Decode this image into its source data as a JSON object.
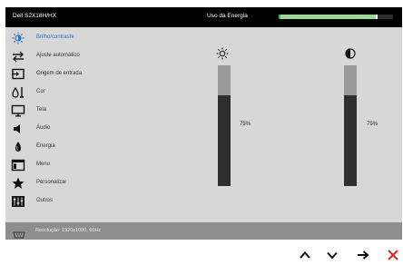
{
  "header": {
    "model": "Dell S2X18H/HX",
    "energy_label": "Uso da Energia",
    "energy_level": 0.85
  },
  "menu": {
    "items": [
      {
        "id": "brightness",
        "label": "Brilho/contraste",
        "icon": "brightness-icon",
        "active": true
      },
      {
        "id": "auto-adjust",
        "label": "Ajuste automático",
        "icon": "auto-adjust-icon",
        "active": false
      },
      {
        "id": "input-source",
        "label": "Origem de entrada",
        "icon": "input-source-icon",
        "active": false
      },
      {
        "id": "color",
        "label": "Cor",
        "icon": "color-icon",
        "active": false
      },
      {
        "id": "display",
        "label": "Tela",
        "icon": "display-icon",
        "active": false
      },
      {
        "id": "audio",
        "label": "Áudio",
        "icon": "audio-icon",
        "active": false
      },
      {
        "id": "energy",
        "label": "Energia",
        "icon": "energy-icon",
        "active": false
      },
      {
        "id": "menu",
        "label": "Menu",
        "icon": "menu-icon",
        "active": false
      },
      {
        "id": "personalize",
        "label": "Personalizar",
        "icon": "star-icon",
        "active": false
      },
      {
        "id": "others",
        "label": "Outros",
        "icon": "others-icon",
        "active": false
      }
    ]
  },
  "brightness": {
    "icon": "sun-icon",
    "value_label": "75%",
    "value": 0.75
  },
  "contrast": {
    "icon": "contrast-icon",
    "value_label": "75%",
    "value": 0.75
  },
  "status": {
    "resolution": "Resolução: 1920x1080, 60Hz",
    "icon": "video-port-icon"
  },
  "buttons": [
    {
      "name": "up-button",
      "icon": "chevron-up-icon"
    },
    {
      "name": "down-button",
      "icon": "chevron-down-icon"
    },
    {
      "name": "enter-button",
      "icon": "arrow-right-icon"
    },
    {
      "name": "exit-button",
      "icon": "close-icon"
    }
  ],
  "colors": {
    "accent": "#2a73c7",
    "energy_fill": "#9fd49a",
    "exit": "#e02020"
  }
}
